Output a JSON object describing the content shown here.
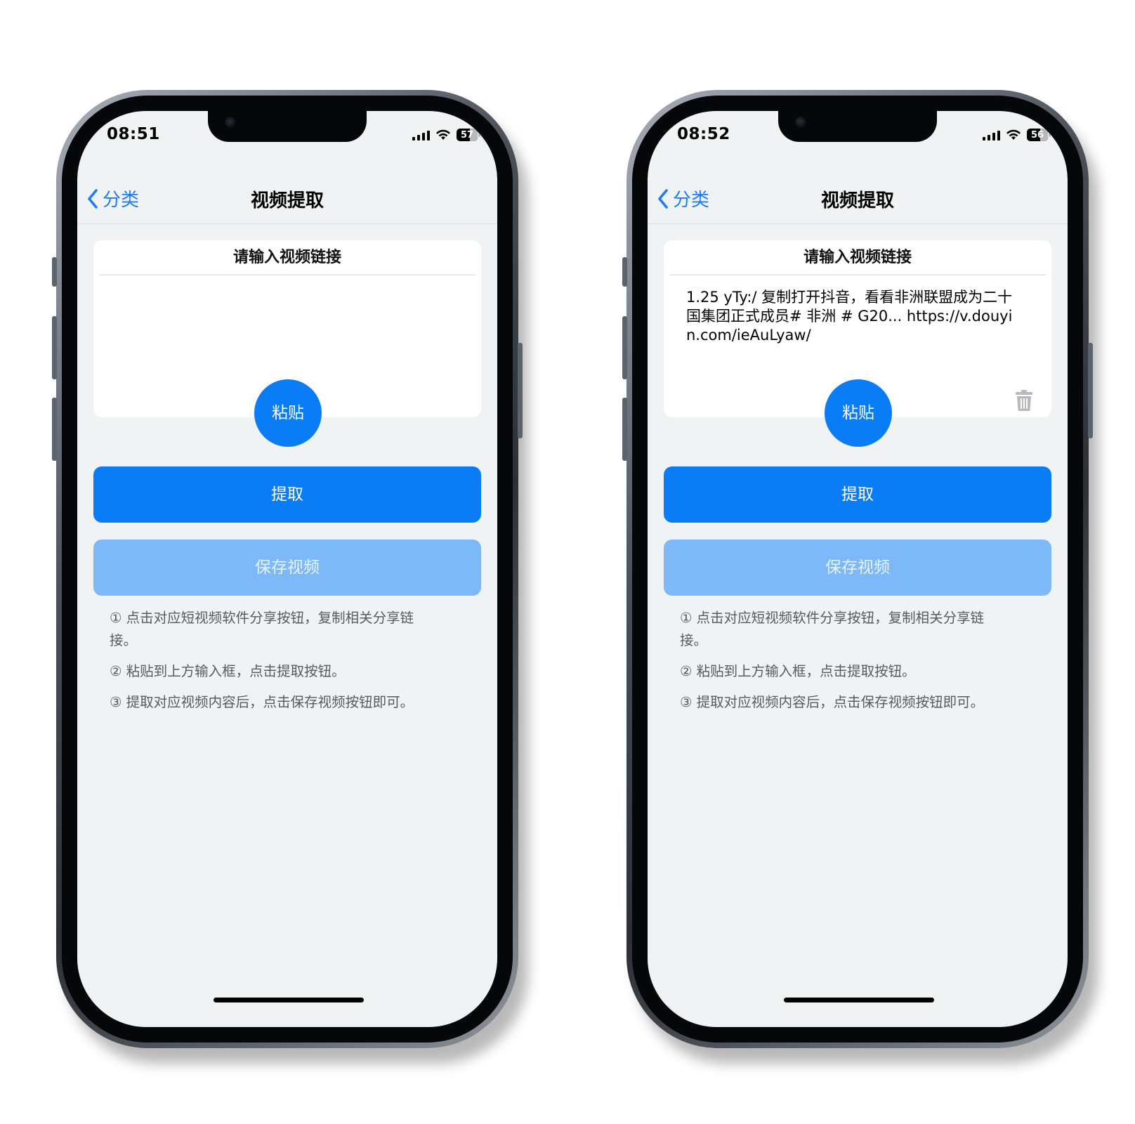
{
  "accent_color": "#0a7cf6",
  "disabled_color": "#7db8f8",
  "screenshots": [
    {
      "status": {
        "time": "08:51",
        "battery": "57"
      },
      "nav": {
        "back_label": "分类",
        "title": "视频提取"
      },
      "input_card": {
        "title": "请输入视频链接",
        "value": ""
      },
      "paste_button": "粘贴",
      "extract_button": "提取",
      "save_button": "保存视频",
      "tips": [
        "① 点击对应短视频软件分享按钮，复制相关分享链接。",
        "② 粘贴到上方输入框，点击提取按钮。",
        "③ 提取对应视频内容后，点击保存视频按钮即可。"
      ]
    },
    {
      "status": {
        "time": "08:52",
        "battery": "56"
      },
      "nav": {
        "back_label": "分类",
        "title": "视频提取"
      },
      "input_card": {
        "title": "请输入视频链接",
        "value": "1.25 yTy:/ 复制打开抖音，看看非洲联盟成为二十国集团正式成员# 非洲 # G20... https://v.douyin.com/ieAuLyaw/"
      },
      "paste_button": "粘贴",
      "extract_button": "提取",
      "save_button": "保存视频",
      "tips": [
        "① 点击对应短视频软件分享按钮，复制相关分享链接。",
        "② 粘贴到上方输入框，点击提取按钮。",
        "③ 提取对应视频内容后，点击保存视频按钮即可。"
      ]
    }
  ]
}
